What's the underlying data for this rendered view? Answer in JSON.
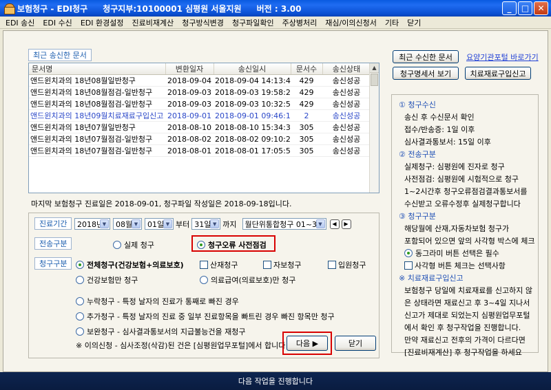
{
  "window": {
    "title_app": "보험청구 - EDI청구",
    "title_branch": "청구지부:10100001 심평원 서울지원",
    "title_version": "버전 : 3.00"
  },
  "menu": [
    "EDI 송신",
    "EDI 수신",
    "EDI 환경설정",
    "진료비재계산",
    "청구방식변경",
    "청구파일확인",
    "주상병처리",
    "재심/이의신청서",
    "기타",
    "닫기"
  ],
  "recent": {
    "label": "최근 송신한 문서",
    "columns": [
      "문서명",
      "변환일자",
      "송신일시",
      "문서수",
      "송신상태"
    ],
    "rows": [
      [
        "앤드윈치과의 18년08월일반청구",
        "2018-09-04",
        "2018-09-04 14:13:45",
        "429",
        "송신성공"
      ],
      [
        "앤드윈치과의 18년08월점검-일반청구",
        "2018-09-03",
        "2018-09-03 19:58:25",
        "429",
        "송신성공"
      ],
      [
        "앤드윈치과의 18년08월점검-일반청구",
        "2018-09-03",
        "2018-09-03 10:32:54",
        "429",
        "송신성공"
      ],
      [
        "앤드윈치과의 18년09월치료재료구입신고",
        "2018-09-01",
        "2018-09-01 09:46:18",
        "2",
        "송신성공"
      ],
      [
        "앤드윈치과의 18년07월일반청구",
        "2018-08-10",
        "2018-08-10 15:34:33",
        "305",
        "송신성공"
      ],
      [
        "앤드윈치과의 18년07월점검-일반청구",
        "2018-08-02",
        "2018-08-02 09:10:21",
        "305",
        "송신성공"
      ],
      [
        "앤드윈치과의 18년07월점검-일반청구",
        "2018-08-01",
        "2018-08-01 17:05:57",
        "305",
        "송신성공"
      ]
    ]
  },
  "last_claim": "마지막 보험청구 진료일은 2018-09-01, 청구파일 작성일은 2018-09-18입니다.",
  "period": {
    "label": "진료기간",
    "year": "2018년",
    "month": "08월",
    "day": "01일",
    "from_label": "부터",
    "to_day": "31일",
    "to_label": "까지",
    "range": "월단위통합청구 01~31"
  },
  "send_type": {
    "label": "전송구분",
    "opt1": "실제 청구",
    "opt2": "청구오류 사전점검"
  },
  "claim_type": {
    "label": "청구구분",
    "all": "전체청구(건강보험+의료보호)",
    "sanjae": "산재청구",
    "jabo": "자보청구",
    "ipwon": "입원청구",
    "health_only": "건강보험만 청구",
    "medical_aid_only": "의료급여(의료보호)만 청구",
    "omission": "누락청구 - 특정 날자의 진료가 통째로 빠진 경우",
    "addition": "추가청구 - 특정 날자의 진료 중 일부 진료항목을 빠트린 경우 빠진 항목만 청구",
    "supplement": "보완청구 - 심사결과통보서의 지급불능건을 재청구",
    "note": "※ 이의신청 - 심사조정(삭감)된 건은 [심평원업무포털]에서 합니다"
  },
  "buttons": {
    "recent_received": "최근 수신한 문서",
    "portal_link": "요양기관포털 바로가기",
    "claim_statement": "청구명세서 보기",
    "material_report": "치료재료구입신고",
    "next": "다음 ▶",
    "close": "닫기"
  },
  "info": [
    {
      "text": "① 청구수신",
      "head": true
    },
    {
      "text": "송신 후 수신문서 확인"
    },
    {
      "text": "접수/반송증: 1일 이후"
    },
    {
      "text": "심사결과통보서: 15일 이후"
    },
    {
      "text": "② 전송구분",
      "head": true
    },
    {
      "text": "실제청구: 심평원에 진자로 청구"
    },
    {
      "text": "사전점검: 심평원에 시험적으로 청구"
    },
    {
      "text": "1~2시간후 청구오류점검결과통보서를"
    },
    {
      "text": "수신받고 오류수정후 실제청구합니다"
    },
    {
      "text": "③ 청구구분",
      "head": true
    },
    {
      "text": "해당월에 산재,자동차보험 청구가"
    },
    {
      "text": "포함되어 있으면 앞의 사각형 박스에 체크"
    },
    {
      "text": "동그라미 버튼 선택은 필수"
    },
    {
      "text": "사각형 버튼 체크는 선택사항"
    },
    {
      "text": "※ 치료재료구입신고",
      "head": true
    },
    {
      "text": "보험청구 당일에 치료재료를 신고하지 않"
    },
    {
      "text": "은 상태라면 재료신고 후 3~4일 지나서"
    },
    {
      "text": "신고가 제대로 되었는지 심평원업무포털"
    },
    {
      "text": "에서 확인 후 청구작업을 진행합니다."
    },
    {
      "text": "만약 재료신고 전후의 가격이 다르다면"
    },
    {
      "text": "[진료비재계산] 후 청구작업을 하세요"
    }
  ],
  "status": "다음 작업을 진행합니다"
}
